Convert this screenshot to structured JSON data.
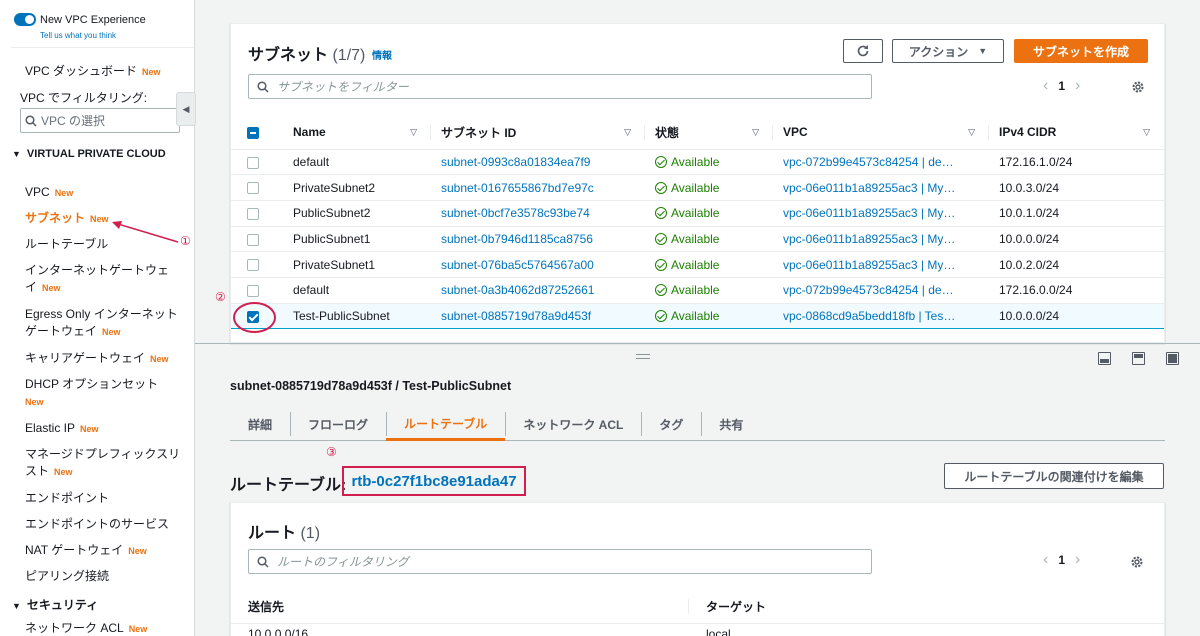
{
  "sidebar": {
    "new_vpc_experience": "New VPC Experience",
    "tell_us": "Tell us what you think",
    "dashboard": "VPC ダッシュボード",
    "filter_label": "VPC でフィルタリング:",
    "vpc_select_placeholder": "VPC の選択",
    "section_vpc": "VIRTUAL PRIVATE CLOUD",
    "section_security": "セキュリティ",
    "new_badge": "New",
    "items": [
      {
        "label": "VPC"
      },
      {
        "label": "サブネット"
      },
      {
        "label": "ルートテーブル"
      },
      {
        "label": "インターネットゲートウェイ"
      },
      {
        "label": "Egress Only インターネットゲートウェイ"
      },
      {
        "label": "キャリアゲートウェイ"
      },
      {
        "label": "DHCP オプションセット"
      },
      {
        "label": "Elastic IP"
      },
      {
        "label": "マネージドプレフィックスリスト"
      },
      {
        "label": "エンドポイント"
      },
      {
        "label": "エンドポイントのサービス"
      },
      {
        "label": "NAT ゲートウェイ"
      },
      {
        "label": "ピアリング接続"
      },
      {
        "label": "ネットワーク ACL"
      }
    ]
  },
  "annotations": {
    "one": "①",
    "two": "②",
    "three": "③"
  },
  "subnets": {
    "title": "サブネット",
    "count": "(1/7)",
    "info": "情報",
    "actions_label": "アクション",
    "create_label": "サブネットを作成",
    "filter_placeholder": "サブネットをフィルター",
    "page": "1",
    "columns": [
      "Name",
      "サブネット ID",
      "状態",
      "VPC",
      "IPv4 CIDR"
    ],
    "rows": [
      {
        "name": "default",
        "id": "subnet-0993c8a01834ea7f9",
        "state": "Available",
        "vpc": "vpc-072b99e4573c84254 | de…",
        "cidr": "172.16.1.0/24"
      },
      {
        "name": "PrivateSubnet2",
        "id": "subnet-0167655867bd7e97c",
        "state": "Available",
        "vpc": "vpc-06e011b1a89255ac3 | My…",
        "cidr": "10.0.3.0/24"
      },
      {
        "name": "PublicSubnet2",
        "id": "subnet-0bcf7e3578c93be74",
        "state": "Available",
        "vpc": "vpc-06e011b1a89255ac3 | My…",
        "cidr": "10.0.1.0/24"
      },
      {
        "name": "PublicSubnet1",
        "id": "subnet-0b7946d1185ca8756",
        "state": "Available",
        "vpc": "vpc-06e011b1a89255ac3 | My…",
        "cidr": "10.0.0.0/24"
      },
      {
        "name": "PrivateSubnet1",
        "id": "subnet-076ba5c5764567a00",
        "state": "Available",
        "vpc": "vpc-06e011b1a89255ac3 | My…",
        "cidr": "10.0.2.0/24"
      },
      {
        "name": "default",
        "id": "subnet-0a3b4062d87252661",
        "state": "Available",
        "vpc": "vpc-072b99e4573c84254 | de…",
        "cidr": "172.16.0.0/24"
      },
      {
        "name": "Test-PublicSubnet",
        "id": "subnet-0885719d78a9d453f",
        "state": "Available",
        "vpc": "vpc-0868cd9a5bedd18fb | Tes…",
        "cidr": "10.0.0.0/24",
        "selected": true
      }
    ]
  },
  "detail": {
    "title": "subnet-0885719d78a9d453f / Test-PublicSubnet",
    "tabs": [
      "詳細",
      "フローログ",
      "ルートテーブル",
      "ネットワーク ACL",
      "タグ",
      "共有"
    ],
    "route_table_label": "ルートテーブル:",
    "route_table_id": "rtb-0c27f1bc8e91ada47",
    "edit_association": "ルートテーブルの関連付けを編集"
  },
  "routes": {
    "title": "ルート",
    "count": "(1)",
    "filter_placeholder": "ルートのフィルタリング",
    "page": "1",
    "columns": [
      "送信先",
      "ターゲット"
    ],
    "rows": [
      {
        "dest": "10.0.0.0/16",
        "target": "local"
      }
    ]
  },
  "colors": {
    "accent": "#ec7211",
    "link": "#0073bb",
    "annotation": "#d01f4f",
    "success": "#1d8102"
  }
}
